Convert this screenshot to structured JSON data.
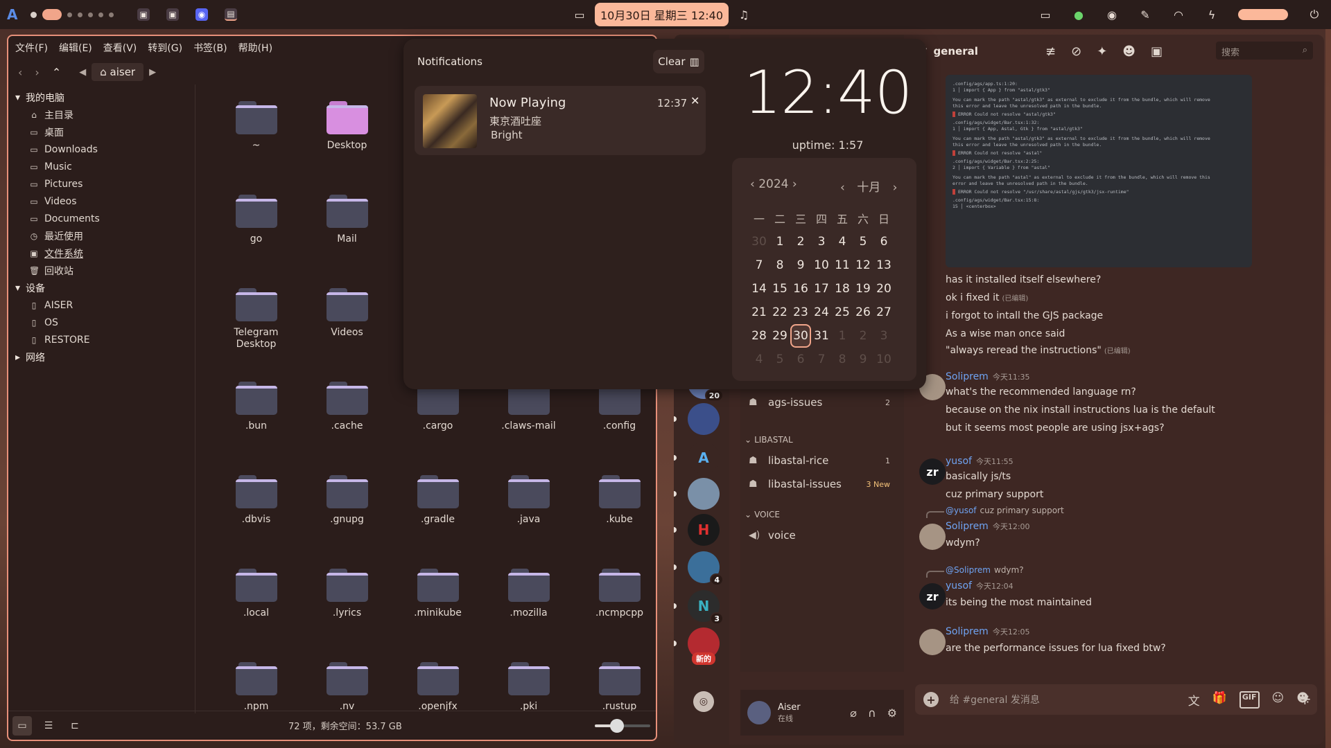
{
  "topbar": {
    "logo": "A",
    "clock": "10月30日 星期三 12:40",
    "icons": [
      "chat-icon",
      "music-note-icon",
      "screen-icon",
      "green-app-icon",
      "discord-icon",
      "color-picker-icon",
      "wifi-icon",
      "volume-icon",
      "charging-icon",
      "power-icon"
    ]
  },
  "file_manager": {
    "menu": [
      "文件(F)",
      "编辑(E)",
      "查看(V)",
      "转到(G)",
      "书签(B)",
      "帮助(H)"
    ],
    "path": "aiser",
    "sidebar": {
      "computer": {
        "title": "我的电脑",
        "items": [
          "主目录",
          "桌面",
          "Downloads",
          "Music",
          "Pictures",
          "Videos",
          "Documents",
          "最近使用",
          "文件系统",
          "回收站"
        ]
      },
      "devices": {
        "title": "设备",
        "items": [
          "AISER",
          "OS",
          "RESTORE"
        ]
      },
      "network": {
        "title": "网络"
      }
    },
    "files": [
      "~",
      "Desktop",
      "",
      "",
      "",
      "go",
      "Mail",
      "",
      "",
      "",
      "Telegram\nDesktop",
      "Videos",
      "",
      "",
      "",
      ".bun",
      ".cache",
      ".cargo",
      ".claws-mail",
      ".config",
      ".dbvis",
      ".gnupg",
      ".gradle",
      ".java",
      ".kube",
      ".local",
      ".lyrics",
      ".minikube",
      ".mozilla",
      ".ncmpcpp",
      ".npm",
      ".nv",
      ".openjfx",
      ".pki",
      ".rustup"
    ],
    "status": "72 项，剩余空间：53.7 GB",
    "zoom_level": 0.4
  },
  "notifications": {
    "title": "Notifications",
    "clear_label": "Clear",
    "card": {
      "title": "Now Playing",
      "time": "12:37",
      "line1": "東京酒吐座",
      "line2": "Bright"
    }
  },
  "clock": {
    "time": "12:40",
    "uptime": "uptime: 1:57"
  },
  "calendar": {
    "year": "2024",
    "month": "十月",
    "weekdays": [
      "一",
      "二",
      "三",
      "四",
      "五",
      "六",
      "日"
    ],
    "days": [
      {
        "d": "30",
        "dim": true
      },
      {
        "d": "1"
      },
      {
        "d": "2"
      },
      {
        "d": "3"
      },
      {
        "d": "4"
      },
      {
        "d": "5"
      },
      {
        "d": "6"
      },
      {
        "d": "7"
      },
      {
        "d": "8"
      },
      {
        "d": "9"
      },
      {
        "d": "10"
      },
      {
        "d": "11"
      },
      {
        "d": "12"
      },
      {
        "d": "13"
      },
      {
        "d": "14"
      },
      {
        "d": "15"
      },
      {
        "d": "16"
      },
      {
        "d": "17"
      },
      {
        "d": "18"
      },
      {
        "d": "19"
      },
      {
        "d": "20"
      },
      {
        "d": "21"
      },
      {
        "d": "22"
      },
      {
        "d": "23"
      },
      {
        "d": "24"
      },
      {
        "d": "25"
      },
      {
        "d": "26"
      },
      {
        "d": "27"
      },
      {
        "d": "28"
      },
      {
        "d": "29"
      },
      {
        "d": "30",
        "today": true
      },
      {
        "d": "31"
      },
      {
        "d": "1",
        "dim": true
      },
      {
        "d": "2",
        "dim": true
      },
      {
        "d": "3",
        "dim": true
      },
      {
        "d": "4",
        "dim": true
      },
      {
        "d": "5",
        "dim": true
      },
      {
        "d": "6",
        "dim": true
      },
      {
        "d": "7",
        "dim": true
      },
      {
        "d": "8",
        "dim": true
      },
      {
        "d": "9",
        "dim": true
      },
      {
        "d": "10",
        "dim": true
      }
    ]
  },
  "discord": {
    "servers": [
      {
        "badge": "20",
        "color": "#6a7fb8"
      },
      {
        "badge": "",
        "color": "#3b4f8a"
      },
      {
        "badge": "",
        "color": "#3a2622",
        "glyph": "A"
      },
      {
        "badge": "",
        "color": "#7a90a8"
      },
      {
        "badge": "",
        "color": "#1a1a1a",
        "glyph": "H"
      },
      {
        "badge": "4",
        "color": "#3b6f9a"
      },
      {
        "badge": "3",
        "color": "#2c2c2c",
        "glyph": "N"
      },
      {
        "badge": "",
        "color": "#b42a30"
      }
    ],
    "new_label": "新的",
    "channels": {
      "top_channel": {
        "name": "ags-issues",
        "count": "2"
      },
      "section_libastal": "LIBASTAL",
      "libastal_rice": {
        "name": "libastal-rice",
        "count": "1"
      },
      "libastal_issues": {
        "name": "libastal-issues",
        "count": "3 New"
      },
      "section_voice": "VOICE",
      "voice": {
        "name": "voice"
      }
    },
    "user": {
      "name": "Aiser",
      "status": "在线"
    },
    "chat": {
      "channel": "general",
      "search_placeholder": "搜索",
      "code_lines": [
        ".config/ags/app.ts:1:20:",
        "  1 │ import { App } from \"astal/gtk3\"",
        "You can mark the path \"astal/gtk3\" as external to exclude it from the bundle, which will remove",
        "this error and leave the unresolved path in the bundle.",
        "ERROR Could not resolve \"astal/gtk3\"",
        ".config/ags/widget/Bar.tsx:1:32:",
        "  1 │ import { App, Astal, Gtk } from \"astal/gtk3\"",
        "You can mark the path \"astal/gtk3\" as external to exclude it from the bundle, which will remove",
        "this error and leave the unresolved path in the bundle.",
        "ERROR Could not resolve \"astal\"",
        ".config/ags/widget/Bar.tsx:2:25:",
        "  2 │ import { Variable } from \"astal\"",
        "You can mark the path \"astal\" as external to exclude it from the bundle, which will remove this",
        "error and leave the unresolved path in the bundle.",
        "ERROR Could not resolve \"/usr/share/astal/gjs/gtk3/jsx-runtime\"",
        ".config/ags/widget/Bar.tsx:15:8:",
        "  15 │     <centerbox>"
      ],
      "lines_top": [
        {
          "text": "has it installed itself elsewhere?",
          "edit": ""
        },
        {
          "text": "ok i fixed it",
          "edit": "(已编辑)"
        },
        {
          "text": "i forgot to intall the GJS package",
          "edit": ""
        },
        {
          "text": "As a wise man once said",
          "edit": ""
        },
        {
          "text": "\"always reread the instructions\"",
          "edit": "(已编辑)"
        }
      ],
      "msg1": {
        "author": "Soliprem",
        "time": "今天11:35",
        "lines": [
          "what's the recommended language rn?",
          "because on the nix install instructions lua is the default",
          "but it seems most people are using jsx+ags?"
        ]
      },
      "msg2": {
        "author": "yusof",
        "time": "今天11:55",
        "avatar": "zr",
        "lines": [
          "basically js/ts",
          "cuz primary support"
        ]
      },
      "msg3": {
        "reply_to": "@yusof",
        "reply_text": "cuz primary support",
        "author": "Soliprem",
        "time": "今天12:00",
        "lines": [
          "wdym?"
        ]
      },
      "msg4": {
        "reply_to": "@Soliprem",
        "reply_text": "wdym?",
        "author": "yusof",
        "time": "今天12:04",
        "avatar": "zr",
        "lines": [
          "its being the most maintained"
        ]
      },
      "msg5": {
        "author": "Soliprem",
        "time": "今天12:05",
        "lines": [
          "are the performance issues for lua fixed btw?"
        ]
      },
      "composer_placeholder": "给 #general 发消息",
      "gif_label": "GIF"
    }
  }
}
